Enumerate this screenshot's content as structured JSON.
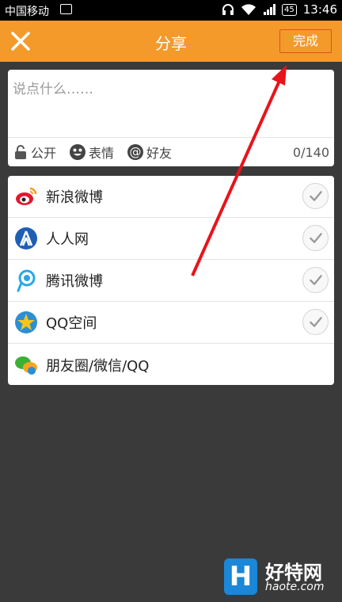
{
  "status_bar": {
    "carrier": "中国移动",
    "battery": "45",
    "time": "13:46"
  },
  "header": {
    "title": "分享",
    "done_label": "完成"
  },
  "compose": {
    "placeholder": "说点什么……",
    "visibility_label": "公开",
    "emoji_label": "表情",
    "friends_label": "好友",
    "counter": "0/140"
  },
  "share_targets": [
    {
      "label": "新浪微博",
      "checked": true
    },
    {
      "label": "人人网",
      "checked": true
    },
    {
      "label": "腾讯微博",
      "checked": true
    },
    {
      "label": "QQ空间",
      "checked": true
    },
    {
      "label": "朋友圈/微信/QQ"
    }
  ],
  "watermark": {
    "logo_letter": "H",
    "site_cn": "好特网",
    "site_en": "haote.com"
  },
  "colors": {
    "accent": "#f39a2b",
    "done_border": "#e0501c",
    "arrow": "#e8141b",
    "background": "#3a3a3a"
  }
}
